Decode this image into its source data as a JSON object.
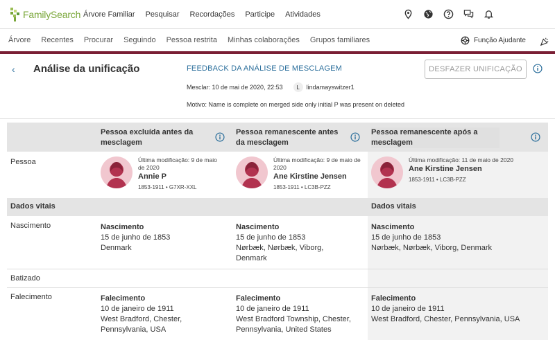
{
  "brand": {
    "name_part1": "Family",
    "name_part2": "Search"
  },
  "main_nav": [
    "Árvore Familiar",
    "Pesquisar",
    "Recordações",
    "Participe",
    "Atividades"
  ],
  "sub_nav": [
    "Árvore",
    "Recentes",
    "Procurar",
    "Seguindo",
    "Pessoa restrita",
    "Minhas colaborações",
    "Grupos familiares"
  ],
  "helper_label": "Função Ajudante",
  "page": {
    "title": "Análise da unificação",
    "feedback_link": "FEEDBACK DA ANÁLISE DE MESCLAGEM",
    "merge_date": "Mesclar: 10 de mai de 2020, 22:53",
    "user_initial": "L",
    "username": "lindamayswitzer1",
    "reason": "Motivo: Name is complete on merged side only initial P was present on deleted",
    "undo_button": "DESFAZER UNIFICAÇÃO"
  },
  "columns": [
    "Pessoa excluída antes da mesclagem",
    "Pessoa remanescente antes da mesclagem",
    "Pessoa remanescente após a mesclagem"
  ],
  "labels": {
    "person": "Pessoa",
    "vitals": "Dados vitais",
    "vitals_right": "Dados vitais",
    "birth": "Nascimento",
    "christening": "Batizado",
    "death": "Falecimento"
  },
  "persons": [
    {
      "modified": "Última modificação: 9 de maio de 2020",
      "name": "Annie P",
      "meta": "1853-1911 • G7XR-XXL"
    },
    {
      "modified": "Última modificação: 9 de maio de 2020",
      "name": "Ane Kirstine Jensen",
      "meta": "1853-1911 • LC3B-PZZ"
    },
    {
      "modified": "Última modificação: 11 de maio de 2020",
      "name": "Ane Kirstine Jensen",
      "meta": "1853-1911 • LC3B-PZZ"
    }
  ],
  "births": [
    {
      "title": "Nascimento",
      "date": "15 de junho de 1853",
      "place": "Denmark"
    },
    {
      "title": "Nascimento",
      "date": "15 de junho de 1853",
      "place": "Nørbæk, Nørbæk, Viborg, Denmark"
    },
    {
      "title": "Nascimento",
      "date": "15 de junho de 1853",
      "place": "Nørbæk, Nørbæk, Viborg, Denmark"
    }
  ],
  "deaths": [
    {
      "title": "Falecimento",
      "date": "10 de janeiro de 1911",
      "place": "West Bradford, Chester, Pennsylvania, USA"
    },
    {
      "title": "Falecimento",
      "date": "10 de janeiro de 1911",
      "place": "West Bradford Township, Chester, Pennsylvania, United States"
    },
    {
      "title": "Falecimento",
      "date": "10 de janeiro de 1911",
      "place": "West Bradford, Chester, Pennsylvania, USA"
    }
  ],
  "colors": {
    "accent_link": "#2a6e9b",
    "brand_green": "#7aa73a",
    "bar": "#7a1f35",
    "avatar_bg": "#f1c7cf",
    "avatar_fg": "#b2324f"
  }
}
